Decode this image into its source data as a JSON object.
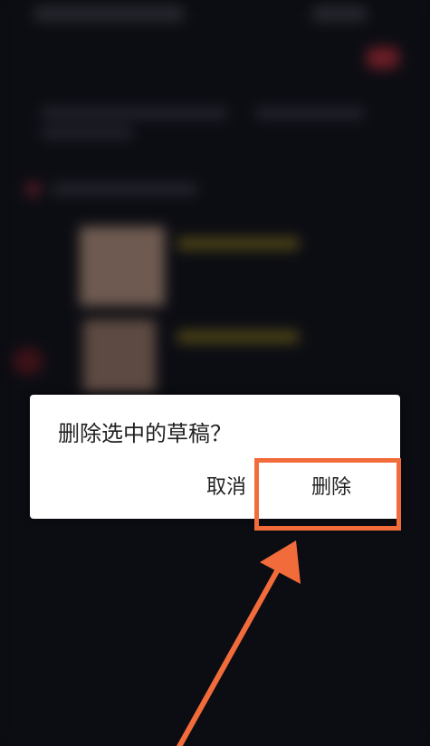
{
  "dialog": {
    "message": "删除选中的草稿？",
    "cancel_label": "取消",
    "delete_label": "删除"
  },
  "colors": {
    "annotation": "#f26b3a",
    "dialog_background": "#ffffff",
    "text": "#222222"
  },
  "icons": [
    "arrow-annotation"
  ]
}
